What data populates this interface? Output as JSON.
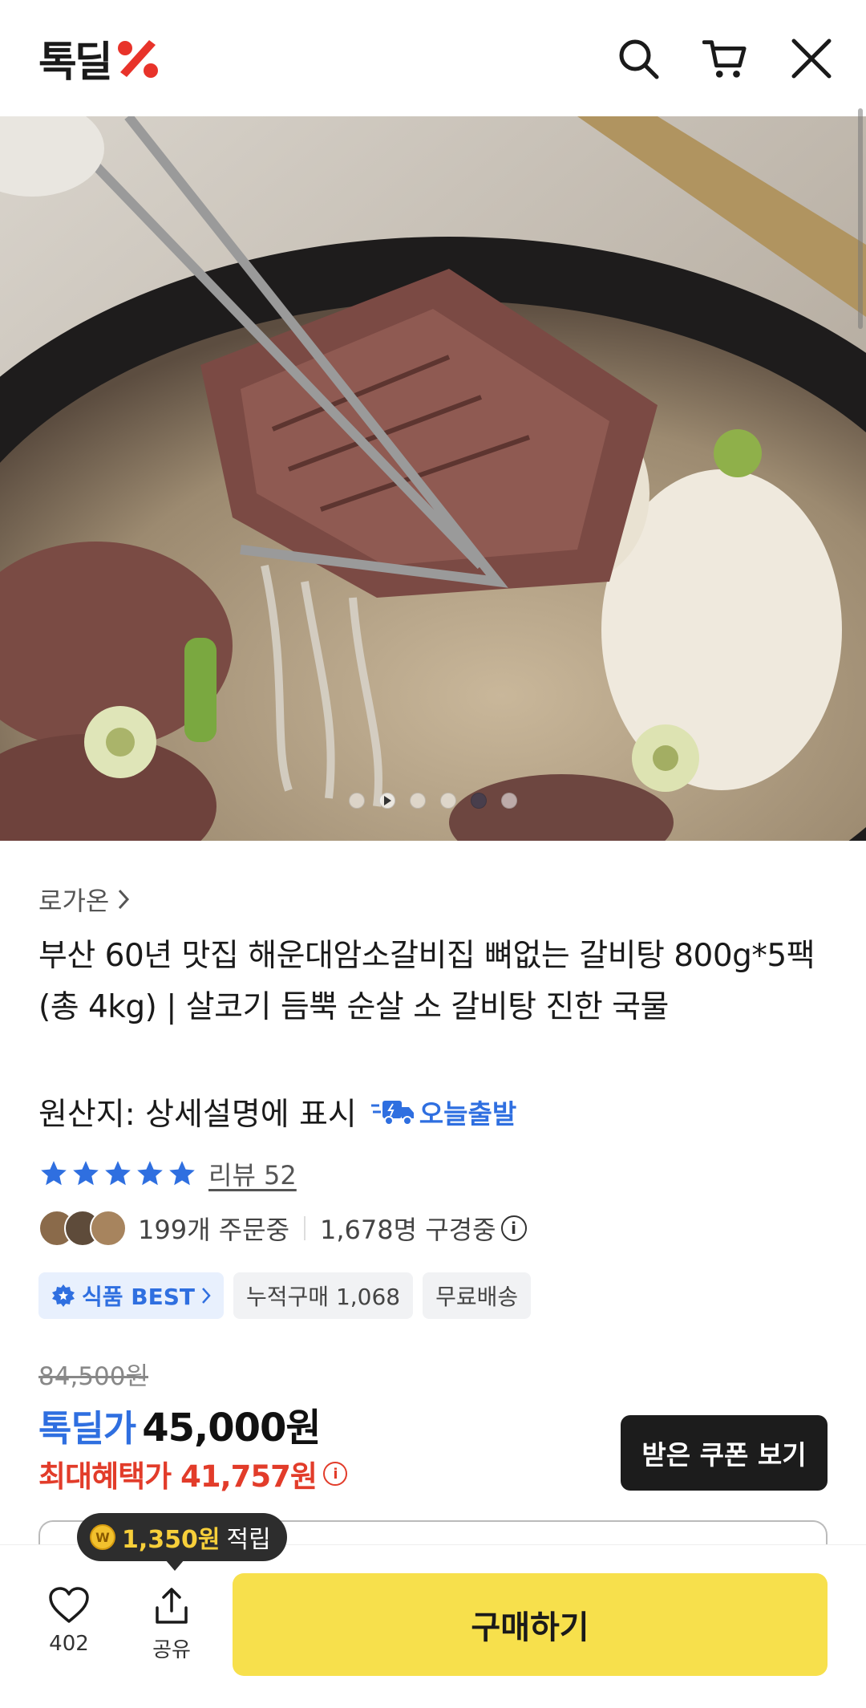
{
  "header": {
    "logo_text": "톡딜",
    "icons": [
      "search-icon",
      "cart-icon",
      "close-icon"
    ]
  },
  "hero": {
    "slide_count": 6,
    "active_slide": 5
  },
  "product": {
    "seller": "로가온",
    "title": "부산 60년 맛집 해운대암소갈비집 뼈없는 갈비탕 800g*5팩 (총 4kg) | 살코기 듬뿍 순살 소 갈비탕 진한 국물",
    "origin": "원산지: 상세설명에 표시",
    "shipping_badge": "오늘출발",
    "rating_stars": 5,
    "review_link": "리뷰 52",
    "orders": "199개 주문중",
    "viewers": "1,678명 구경중",
    "tags": [
      "식품 BEST",
      "누적구매 1,068",
      "무료배송"
    ]
  },
  "price": {
    "original": "84,500원",
    "deal_label": "톡딜가",
    "deal_price": "45,000원",
    "max_benefit": "최대혜택가 41,757원",
    "coupon_button": "받은 쿠폰 보기"
  },
  "bottom_bar": {
    "like_count": "402",
    "share_label": "공유",
    "buy_button": "구매하기",
    "tooltip_amount": "1,350원",
    "tooltip_suffix": "적립"
  },
  "colors": {
    "accent_blue": "#2f6fe0",
    "accent_red": "#e23c2a",
    "buy_yellow": "#f7e04c"
  }
}
